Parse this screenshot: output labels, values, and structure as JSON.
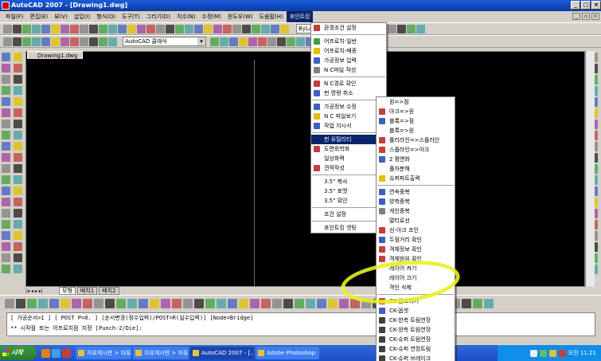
{
  "window": {
    "title": "AutoCAD 2007 - [Drawing1.dwg]"
  },
  "menubar": [
    "파일(F)",
    "편집(E)",
    "뷰(V)",
    "삽입(I)",
    "형식(O)",
    "도구(T)",
    "그리기(D)",
    "치수(N)",
    "수정(M)",
    "윈도우(W)",
    "도움말(H)",
    "포인트킹"
  ],
  "toolbar2": {
    "style_combo": "AutoCAD 클래식",
    "layer_combo": "ByLayer"
  },
  "drawing": {
    "tab": "Drawing1.dwg"
  },
  "layout_tabs": [
    "모형",
    "배치1",
    "배치2"
  ],
  "command": {
    "line1": "[ 가공순서=1 ] [ POST P=0. ] [순서변경(정수입력)/POST=R(실수입력)] [Node=Bridge]",
    "line2": "** 시작점 또는 어프로치점 지정 [Punch-2/Die]:"
  },
  "menu_main": [
    {
      "label": "환경조건 설정",
      "icon_color": "#c04040"
    },
    {
      "sep": true
    },
    {
      "label": "어프로치-일반",
      "icon_color": "#40a040"
    },
    {
      "label": "어프로치-배종",
      "icon_color": "#e0c000"
    },
    {
      "label": "가공정보 입력",
      "icon_color": "#4060c0"
    },
    {
      "label": "N C파일 작성",
      "icon_color": "#808080"
    },
    {
      "sep": true
    },
    {
      "label": "N C경로 확인",
      "icon_color": "#c04040"
    },
    {
      "label": "펀 명령 취소",
      "icon_color": "#4060c0"
    },
    {
      "sep": true
    },
    {
      "label": "가공정보 수정",
      "icon_color": "#4060c0"
    },
    {
      "label": "N C 파일보기",
      "icon_color": "#e0c000"
    },
    {
      "label": "작업 지시서",
      "icon_color": "#4060c0"
    },
    {
      "sep": true
    },
    {
      "label": "펀 유틸리티",
      "icon_color": "",
      "arrow": true,
      "selected": true
    },
    {
      "label": "도면회학화",
      "icon_color": "#c04040"
    },
    {
      "label": "일상화력",
      "icon_color": ""
    },
    {
      "label": "견적작성",
      "icon_color": "#c04040"
    },
    {
      "sep": true
    },
    {
      "label": "3.5\" 복사",
      "icon_color": "",
      "arrow": true
    },
    {
      "label": "3.5\" 포맷",
      "icon_color": "",
      "arrow": true
    },
    {
      "label": "3.5\" 확인",
      "icon_color": "",
      "arrow": true
    },
    {
      "sep": true
    },
    {
      "label": "조건 설정",
      "icon_color": "",
      "arrow": true
    },
    {
      "sep": true
    },
    {
      "label": "포인트킹 셋팅",
      "icon_color": ""
    }
  ],
  "menu_sub": [
    {
      "label": "원=>점",
      "icon_color": ""
    },
    {
      "label": "아크=>원",
      "icon_color": "#c04040"
    },
    {
      "label": "블록=>점",
      "icon_color": "#4060c0"
    },
    {
      "label": "블록=>원",
      "icon_color": ""
    },
    {
      "label": "폴리라인=>스플라인",
      "icon_color": "#c04040"
    },
    {
      "label": "스플라인=>아크",
      "icon_color": "#c04040"
    },
    {
      "label": "2 평면화",
      "icon_color": "#4060c0"
    },
    {
      "label": "폴자분해",
      "icon_color": ""
    },
    {
      "label": "슈퍼파트출력",
      "icon_color": "#e0c000"
    },
    {
      "sep": true
    },
    {
      "label": "연속중복",
      "icon_color": "#4060c0"
    },
    {
      "label": "양측중복",
      "icon_color": "#4060c0"
    },
    {
      "label": "게인중복",
      "icon_color": "#808080"
    },
    {
      "label": "멀티로선",
      "icon_color": ""
    },
    {
      "label": "선-아크 조인",
      "icon_color": "#c04040"
    },
    {
      "label": "두점거리 확인",
      "icon_color": "#4060c0"
    },
    {
      "label": "객체정보 확인",
      "icon_color": "#c04040"
    },
    {
      "label": "객체범위 확인",
      "icon_color": "#c04040"
    },
    {
      "label": "레이어 켜기",
      "icon_color": ""
    },
    {
      "label": "레이어 끄기",
      "icon_color": ""
    },
    {
      "label": "객인 삭제",
      "icon_color": ""
    },
    {
      "sep": true
    },
    {
      "label": "CK-원그리기",
      "icon_color": "#c04040"
    },
    {
      "label": "CK-옵셋",
      "icon_color": "#4060c0"
    },
    {
      "label": "CK-한측 트림연장",
      "icon_color": "#404040"
    },
    {
      "label": "CK-양측 트림연장",
      "icon_color": "#404040"
    },
    {
      "label": "CK-슈퍼 트림연장",
      "icon_color": "#404040"
    },
    {
      "label": "CK-슈퍼 연장트림",
      "icon_color": "#404040"
    },
    {
      "label": "CK-슈퍼 브레이크",
      "icon_color": "#404040"
    }
  ],
  "taskbar": {
    "start": "시작",
    "items": [
      "자유게시판 > 자유...",
      "자유게시판 > 자유...",
      "AutoCAD 2007 - [...",
      "Adobe Photoshop"
    ],
    "clock": "오전 11:21"
  },
  "colors": {
    "title_bar": "#0a3aa8",
    "menu_selected": "#0a246a",
    "highlight_marker": "#e8f020"
  }
}
